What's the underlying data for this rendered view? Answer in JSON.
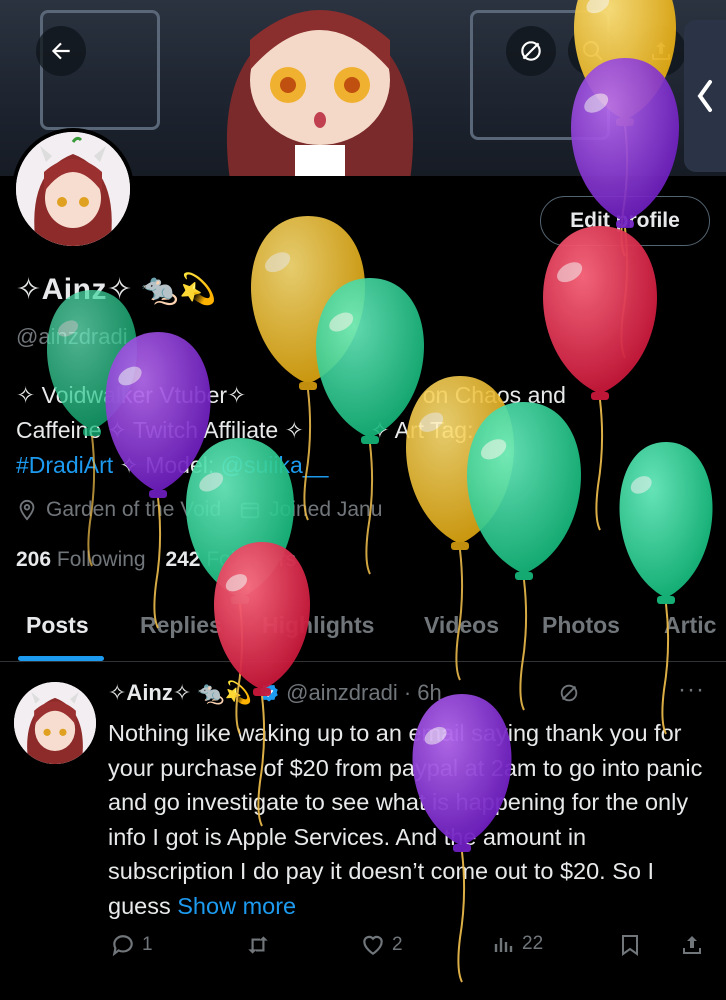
{
  "header": {
    "back_icon": "arrow-left-icon",
    "mute_icon": "slash-circle-icon",
    "search_icon": "search-icon",
    "share_icon": "upload-icon",
    "side_tab_icon": "chevron-left-icon"
  },
  "profile": {
    "edit_label": "Edit profile",
    "name": "✧Ainz✧ 🐀💫",
    "handle": "@ainzdradi",
    "bio_line1": "✧ Voidwalker Vtuber✧ ",
    "bio_line1b": "on Chaos and",
    "bio_line2": "Caffeine ✧ Twitch Affiliate ✧ ",
    "bio_line2b": "✧ Art Tag:",
    "bio_tag": "#DradiArt",
    "bio_line3": " ✧ Model: ",
    "bio_mention": "@suiika__",
    "location": "Garden of the Void",
    "joined": "Joined Janu",
    "following_count": "206",
    "following_label": "Following",
    "followers_count": "242",
    "followers_label": "Followers"
  },
  "tabs": [
    "Posts",
    "Replies",
    "Highlights",
    "Videos",
    "Photos",
    "Artic"
  ],
  "active_tab": "Posts",
  "post": {
    "name": "✧Ainz✧",
    "emoji": "🐀💫",
    "handle_time": "@ainzdradi · 6h",
    "text": "Nothing like waking up to an email saying thank you for your purchase of $20 from paypal at 2am to go into panic and go investigate to see what is happening for the only info I got is Apple Services. And the amount in subscription I do pay it doesn’t come out to $20. So I guess ",
    "show_more": "Show more",
    "more_icon": "···",
    "replies": "1",
    "reposts": "",
    "likes": "2",
    "views": "22"
  },
  "colors": {
    "accent": "#1d9bf0",
    "balloon_yellow": "#f2c12e",
    "balloon_purple": "#8b2fd6",
    "balloon_green": "#2fd69a",
    "balloon_red": "#e8304e"
  }
}
